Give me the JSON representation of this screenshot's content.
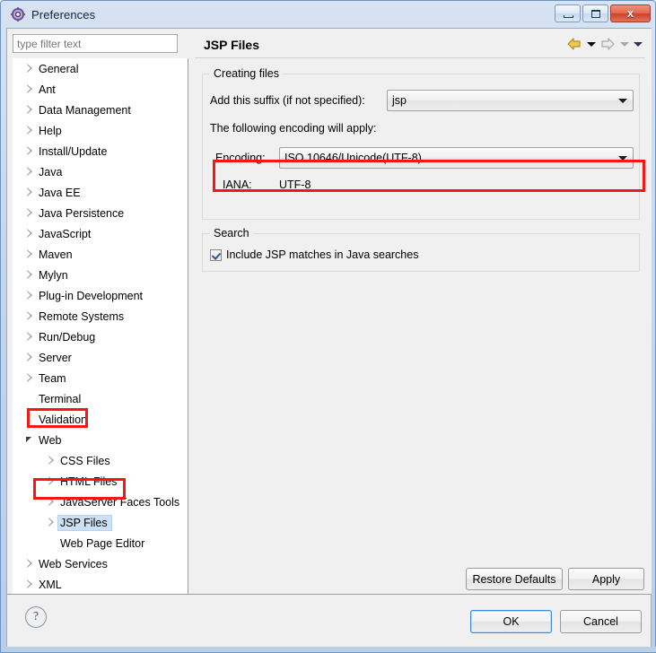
{
  "window": {
    "title": "Preferences",
    "icon": "gear-icon",
    "buttons": {
      "minimize": "minimize-icon",
      "maximize": "maximize-icon",
      "close": "x"
    }
  },
  "sidebar": {
    "filter": {
      "placeholder": "type filter text",
      "value": ""
    },
    "tree": [
      {
        "label": "General",
        "state": "collapsed",
        "level": 0
      },
      {
        "label": "Ant",
        "state": "collapsed",
        "level": 0
      },
      {
        "label": "Data Management",
        "state": "collapsed",
        "level": 0
      },
      {
        "label": "Help",
        "state": "collapsed",
        "level": 0
      },
      {
        "label": "Install/Update",
        "state": "collapsed",
        "level": 0
      },
      {
        "label": "Java",
        "state": "collapsed",
        "level": 0
      },
      {
        "label": "Java EE",
        "state": "collapsed",
        "level": 0
      },
      {
        "label": "Java Persistence",
        "state": "collapsed",
        "level": 0
      },
      {
        "label": "JavaScript",
        "state": "collapsed",
        "level": 0
      },
      {
        "label": "Maven",
        "state": "collapsed",
        "level": 0
      },
      {
        "label": "Mylyn",
        "state": "collapsed",
        "level": 0
      },
      {
        "label": "Plug-in Development",
        "state": "collapsed",
        "level": 0
      },
      {
        "label": "Remote Systems",
        "state": "collapsed",
        "level": 0
      },
      {
        "label": "Run/Debug",
        "state": "collapsed",
        "level": 0
      },
      {
        "label": "Server",
        "state": "collapsed",
        "level": 0
      },
      {
        "label": "Team",
        "state": "collapsed",
        "level": 0
      },
      {
        "label": "Terminal",
        "state": "leaf",
        "level": 0
      },
      {
        "label": "Validation",
        "state": "leaf",
        "level": 0
      },
      {
        "label": "Web",
        "state": "expanded",
        "level": 0,
        "highlighted": true
      },
      {
        "label": "CSS Files",
        "state": "collapsed",
        "level": 1
      },
      {
        "label": "HTML Files",
        "state": "collapsed",
        "level": 1
      },
      {
        "label": "JavaServer Faces Tools",
        "state": "collapsed",
        "level": 1
      },
      {
        "label": "JSP Files",
        "state": "collapsed",
        "level": 1,
        "selected": true,
        "highlighted": true
      },
      {
        "label": "Web Page Editor",
        "state": "leaf",
        "level": 1
      },
      {
        "label": "Web Services",
        "state": "collapsed",
        "level": 0
      },
      {
        "label": "XML",
        "state": "collapsed",
        "level": 0
      }
    ]
  },
  "page": {
    "title": "JSP Files",
    "nav": {
      "back": "back-arrow-icon",
      "back_menu": "chevron-down-icon",
      "forward": "forward-arrow-icon",
      "forward_menu": "chevron-down-icon",
      "view_menu": "chevron-down-icon"
    },
    "creating_files": {
      "group_label": "Creating files",
      "suffix_label": "Add this suffix (if not specified):",
      "suffix_value": "jsp",
      "encoding_intro": "The following encoding will apply:",
      "encoding_label": "Encoding:",
      "encoding_value": "ISO 10646/Unicode(UTF-8)",
      "iana_label": "IANA:",
      "iana_value": "UTF-8"
    },
    "search": {
      "group_label": "Search",
      "checkbox_label": "Include JSP matches in Java searches",
      "checkbox_checked": true
    },
    "restore_defaults_label": "Restore Defaults",
    "apply_label": "Apply"
  },
  "footer": {
    "help": "?",
    "ok_label": "OK",
    "cancel_label": "Cancel"
  },
  "colors": {
    "annotation_red": "#f61616",
    "selection_blue": "#cde0f5",
    "accent_focus": "#3c8ad4"
  }
}
